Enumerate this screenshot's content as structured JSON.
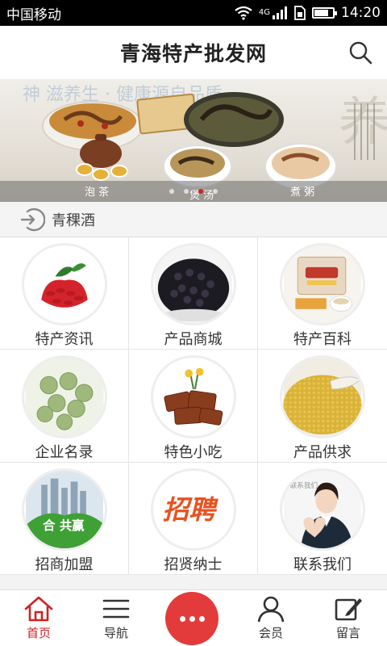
{
  "status_bar": {
    "carrier": "中国移动",
    "network": "4G",
    "time": "14:20",
    "battery_level": 0.75
  },
  "header": {
    "title": "青海特产批发网",
    "search_icon": "search-icon"
  },
  "banner": {
    "slides": 4,
    "active_slide": 3,
    "captions": [
      "泡 茶",
      "煲 汤",
      "煮 粥"
    ],
    "top_text": "神 滋养生 · 健康源自品质",
    "brush_char": "养"
  },
  "category_bar": {
    "label": "青稞酒",
    "icon": "enter-arrow-icon"
  },
  "grid": {
    "items": [
      {
        "label": "特产资讯",
        "image": "goji-berries"
      },
      {
        "label": "产品商城",
        "image": "black-goji"
      },
      {
        "label": "特产百科",
        "image": "barley-milk-tea"
      },
      {
        "label": "企业名录",
        "image": "green-buds"
      },
      {
        "label": "特色小吃",
        "image": "beef-jerky"
      },
      {
        "label": "产品供求",
        "image": "millet-grain"
      },
      {
        "label": "招商加盟",
        "image": "cooperation-win"
      },
      {
        "label": "招贤纳士",
        "image": "recruitment"
      },
      {
        "label": "联系我们",
        "image": "customer-service"
      }
    ],
    "logo_texts": {
      "cooperation": "合 共赢",
      "recruit": "招聘",
      "contact_tag": "联系我们"
    }
  },
  "tabbar": {
    "items": [
      {
        "label": "首页",
        "icon": "home-icon",
        "active": true
      },
      {
        "label": "导航",
        "icon": "menu-icon",
        "active": false
      },
      {
        "label": "",
        "icon": "more-icon",
        "active": false
      },
      {
        "label": "会员",
        "icon": "user-icon",
        "active": false
      },
      {
        "label": "留言",
        "icon": "edit-icon",
        "active": false
      }
    ]
  },
  "colors": {
    "accent": "#d02222",
    "center_button": "#e33b3b"
  }
}
